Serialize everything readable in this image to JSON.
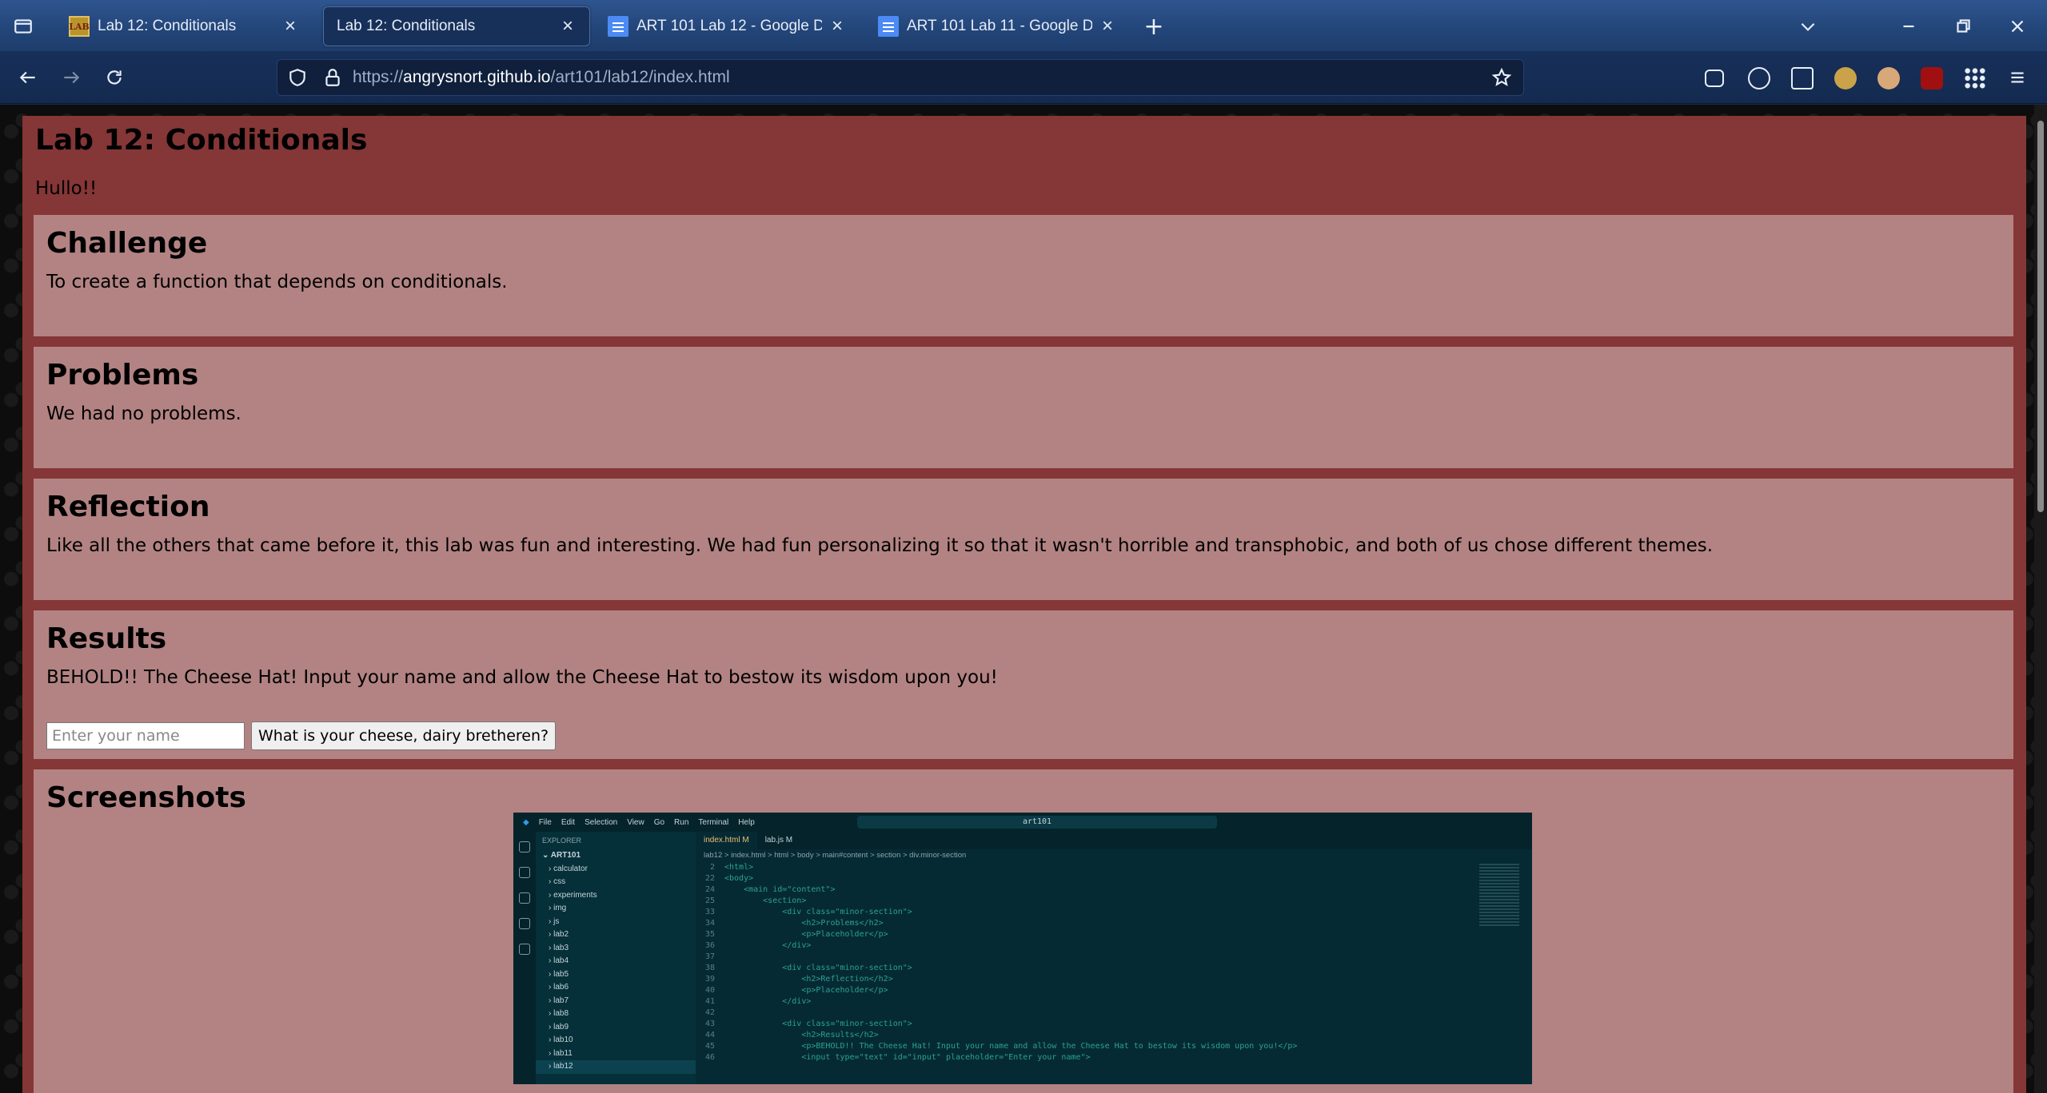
{
  "browser": {
    "tabs": [
      {
        "label": "Lab 12: Conditionals",
        "favicon": "lab-logo-icon",
        "active": false
      },
      {
        "label": "Lab 12: Conditionals",
        "favicon": "none",
        "active": true
      },
      {
        "label": "ART 101 Lab 12 - Google Docs",
        "favicon": "google-docs-icon",
        "active": false
      },
      {
        "label": "ART 101 Lab 11 - Google Docs",
        "favicon": "google-docs-icon",
        "active": false
      }
    ],
    "url_prefix": "https://",
    "url_host": "angrysnort.github.io",
    "url_path": "/art101/lab12/index.html",
    "lab_favicon_text": "LAB"
  },
  "page": {
    "title": "Lab 12: Conditionals",
    "intro": "Hullo!!",
    "sections": {
      "challenge": {
        "heading": "Challenge",
        "body": "To create a function that depends on conditionals."
      },
      "problems": {
        "heading": "Problems",
        "body": "We had no problems."
      },
      "reflection": {
        "heading": "Reflection",
        "body": "Like all the others that came before it, this lab was fun and interesting. We had fun personalizing it so that it wasn't horrible and transphobic, and both of us chose different themes."
      },
      "results": {
        "heading": "Results",
        "body": "BEHOLD!! The Cheese Hat! Input your name and allow the Cheese Hat to bestow its wisdom upon you!",
        "input_placeholder": "Enter your name",
        "button_label": "What is your cheese, dairy bretheren?"
      },
      "screenshots": {
        "heading": "Screenshots"
      }
    },
    "colors": {
      "main_bg": "#853636",
      "section_bg": "#b38383"
    }
  },
  "vscode": {
    "menu": [
      "File",
      "Edit",
      "Selection",
      "View",
      "Go",
      "Run",
      "Terminal",
      "Help"
    ],
    "search": "art101",
    "explorer_header": "EXPLORER",
    "explorer_items": [
      "ART101",
      "calculator",
      "css",
      "experiments",
      "img",
      "js",
      "lab2",
      "lab3",
      "lab4",
      "lab5",
      "lab6",
      "lab7",
      "lab8",
      "lab9",
      "lab10",
      "lab11",
      "lab12"
    ],
    "editor_tabs": [
      "index.html M",
      "lab.js M"
    ],
    "breadcrumb": "lab12 > index.html > html > body > main#content > section > div.minor-section",
    "code_lines": [
      {
        "n": "2",
        "text": "<html>"
      },
      {
        "n": "22",
        "text": "<body>"
      },
      {
        "n": "24",
        "text": "    <main id=\"content\">"
      },
      {
        "n": "25",
        "text": "        <section>"
      },
      {
        "n": "33",
        "text": "            <div class=\"minor-section\">"
      },
      {
        "n": "34",
        "text": "                <h2>Problems</h2>"
      },
      {
        "n": "35",
        "text": "                <p>Placeholder</p>"
      },
      {
        "n": "36",
        "text": "            </div>"
      },
      {
        "n": "37",
        "text": ""
      },
      {
        "n": "38",
        "text": "            <div class=\"minor-section\">"
      },
      {
        "n": "39",
        "text": "                <h2>Reflection</h2>"
      },
      {
        "n": "40",
        "text": "                <p>Placeholder</p>"
      },
      {
        "n": "41",
        "text": "            </div>"
      },
      {
        "n": "42",
        "text": ""
      },
      {
        "n": "43",
        "text": "            <div class=\"minor-section\">"
      },
      {
        "n": "44",
        "text": "                <h2>Results</h2>"
      },
      {
        "n": "45",
        "text": "                <p>BEHOLD!! The Cheese Hat! Input your name and allow the Cheese Hat to bestow its wisdom upon you!</p>"
      },
      {
        "n": "46",
        "text": "                <input type=\"text\" id=\"input\" placeholder=\"Enter your name\">"
      }
    ]
  }
}
